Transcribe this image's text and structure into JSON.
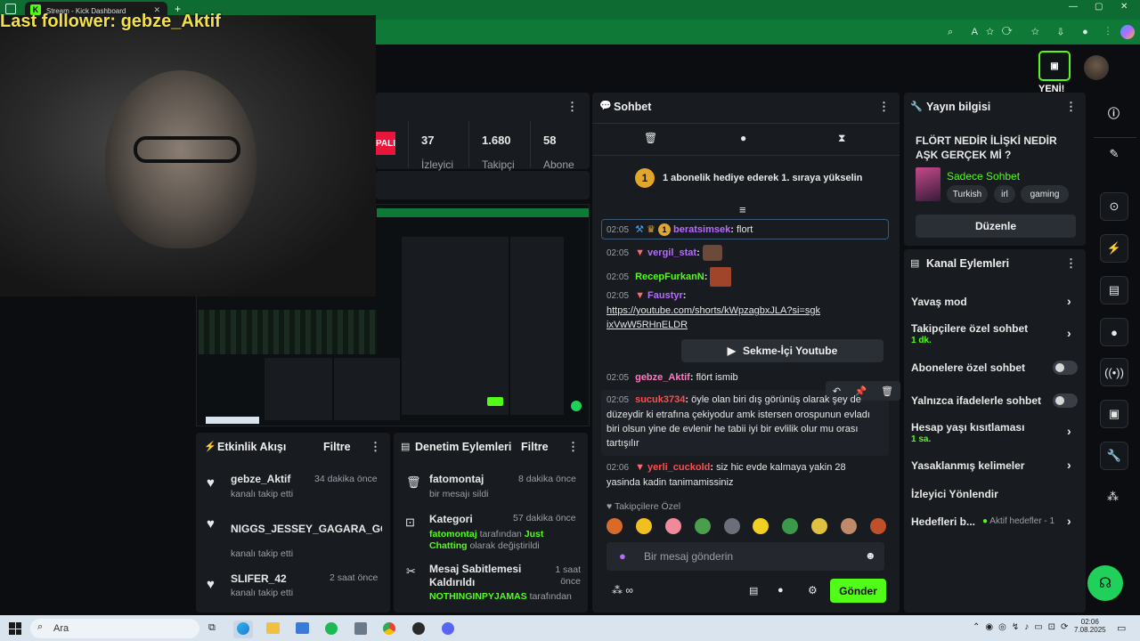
{
  "browser": {
    "tab_title": "Stream - Kick Dashboard",
    "new_tab": "+",
    "favicon": "K",
    "window_controls": [
      "—",
      "▢",
      "✕"
    ]
  },
  "overlay": {
    "last_follower": "Last follower: gebze_Aktif"
  },
  "header": {
    "new_badge": "YENİ!"
  },
  "stream_stats": {
    "live_badge": "PALI",
    "viewers_value": "37",
    "viewers_label": "İzleyici",
    "followers_value": "1.680",
    "followers_label": "Takipçi",
    "subs_value": "58",
    "subs_label": "Abone"
  },
  "activity_feed": {
    "title": "Etkinlik Akışı",
    "filter_label": "Filtre",
    "items": [
      {
        "user": "gebze_Aktif",
        "action": "kanalı takip etti",
        "time": "34 dakika önce"
      },
      {
        "user": "NIGGS_JESSEY_GAGARA_GO(",
        "action": "kanalı takip etti",
        "time": ""
      },
      {
        "user": "SLIFER_42",
        "action": "kanalı takip etti",
        "time": "2 saat önce"
      }
    ]
  },
  "mod_actions": {
    "title": "Denetim Eylemleri",
    "filter_label": "Filtre",
    "items": [
      {
        "user": "fatomontaj",
        "detail": "bir mesajı sildi",
        "time": "8 dakika önce"
      },
      {
        "user": "Kategori",
        "detail_pre": "fatomontaj",
        "detail_mid": " tarafından ",
        "detail_cat": "Just Chatting",
        "detail_post": " olarak değiştirildi",
        "time": "57 dakika önce"
      },
      {
        "user": "Mesaj Sabitlemesi Kaldırıldı",
        "detail_pre": "NOTHINGINPYJAMAS",
        "detail_post": " tarafından",
        "time": "1 saat önce"
      }
    ]
  },
  "chat": {
    "title": "Sohbet",
    "sub_promo": "1 abonelik hediye ederek 1. sıraya yükselin",
    "sub_promo_badge": "1",
    "messages": [
      {
        "time": "02:05",
        "user": "beratsimsek",
        "text": "flort",
        "color": "#b66bff",
        "badge": "1"
      },
      {
        "time": "02:05",
        "user": "vergil_stat",
        "text": "",
        "color": "#b66bff"
      },
      {
        "time": "02:05",
        "user": "RecepFurkanN",
        "text": "",
        "color": "#53fc18"
      },
      {
        "time": "02:05",
        "user": "Faustyr",
        "text": "https://youtube.com/shorts/kWpzagbxJLA?si=sgkixVwW5RHnELDR",
        "color": "#b66bff"
      },
      {
        "time": "02:05",
        "user": "gebze_Aktif",
        "text": "flört ismib",
        "color": "#ff7ac0"
      },
      {
        "time": "02:05",
        "user": "sucuk3734",
        "text": "öyle olan biri dış görünüş olarak şey de düzeydir ki etrafına çekiyodur amk istersen orospunun evladı biri olsun yine de evlenir he tabii iyi bir evlilik olur mu orası tartışılır",
        "color": "#ff4d4d"
      },
      {
        "time": "02:06",
        "user": "yerli_cuckold",
        "text": "siz hic evde kalmaya yakin 28 yasinda kadin tanimamissiniz",
        "color": "#ff4d4d"
      }
    ],
    "youtube_button": "Sekme-İçi Youtube",
    "follower_only_label": "Takipçilere Özel",
    "input_placeholder": "Bir mesaj gönderin",
    "send_label": "Gönder"
  },
  "stream_info": {
    "title": "Yayın bilgisi",
    "stream_title": "FLÖRT NEDİR İLİŞKİ NEDİR AŞK GERÇEK Mİ ?",
    "category": "Sadece Sohbet",
    "tags": [
      "Turkish",
      "irl",
      "gaming"
    ],
    "edit_label": "Düzenle"
  },
  "channel_actions": {
    "title": "Kanal Eylemleri",
    "items": [
      {
        "label": "Yavaş mod",
        "sub": "",
        "control": "chevron"
      },
      {
        "label": "Takipçilere özel sohbet",
        "sub": "1 dk.",
        "control": "chevron"
      },
      {
        "label": "Abonelere özel sohbet",
        "sub": "",
        "control": "toggle"
      },
      {
        "label": "Yalnızca ifadelerle sohbet",
        "sub": "",
        "control": "toggle"
      },
      {
        "label": "Hesap yaşı kısıtlaması",
        "sub": "1 sa.",
        "control": "chevron"
      },
      {
        "label": "Yasaklanmış kelimeler",
        "sub": "",
        "control": "chevron"
      },
      {
        "label": "İzleyici Yönlendir",
        "sub": "",
        "control": "none"
      },
      {
        "label": "Hedefleri b...",
        "sub": "Aktif hedefler - 1",
        "control": "chevron"
      }
    ]
  },
  "taskbar": {
    "search_placeholder": "Ara",
    "time": "02:06",
    "date": "7.08.2025"
  },
  "colors": {
    "kick_green": "#53fc18",
    "panel_bg": "#181b20",
    "page_bg": "#0b0d10",
    "overlay_yellow": "#f2e14a",
    "browser_green": "#0e6b32"
  }
}
